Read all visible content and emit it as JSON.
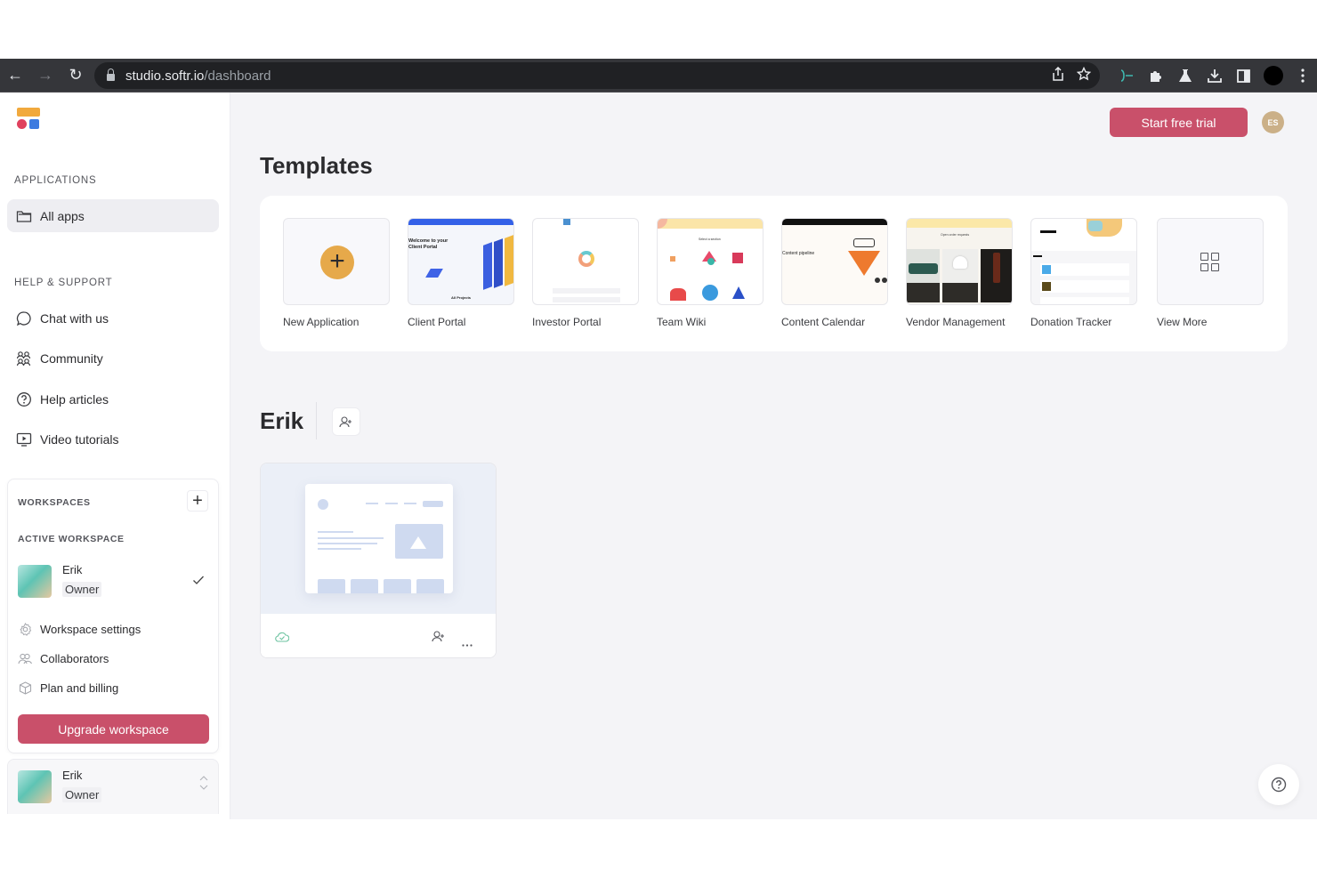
{
  "browser": {
    "url_host": "studio.softr.io",
    "url_path": "/dashboard",
    "nav": {
      "back": "←",
      "forward": "→",
      "reload": "↻"
    },
    "extensions": [
      "share-icon",
      "star-icon",
      "extension-app-icon",
      "puzzle-icon",
      "flask-icon",
      "download-icon",
      "sidebar-icon",
      "profile-icon",
      "menu-icon"
    ]
  },
  "sidebar": {
    "applications_title": "APPLICATIONS",
    "all_apps": "All apps",
    "help_title": "HELP & SUPPORT",
    "help_items": [
      {
        "label": "Chat with us",
        "icon": "chat-bubble-icon"
      },
      {
        "label": "Community",
        "icon": "community-icon"
      },
      {
        "label": "Help articles",
        "icon": "question-circle-icon"
      },
      {
        "label": "Video tutorials",
        "icon": "video-icon"
      }
    ],
    "workspaces": {
      "title": "WORKSPACES",
      "add": "+",
      "active_title": "ACTIVE WORKSPACE",
      "active": {
        "name": "Erik",
        "role": "Owner"
      },
      "links": [
        {
          "label": "Workspace settings",
          "icon": "gear-icon"
        },
        {
          "label": "Collaborators",
          "icon": "users-icon"
        },
        {
          "label": "Plan and billing",
          "icon": "box-icon"
        }
      ],
      "upgrade_label": "Upgrade workspace",
      "switcher": {
        "name": "Erik",
        "role": "Owner"
      }
    }
  },
  "header": {
    "trial_label": "Start free trial",
    "user_initials": "ES",
    "accent": "#c9506a"
  },
  "templates": {
    "title": "Templates",
    "items": [
      {
        "name": "New Application"
      },
      {
        "name": "Client Portal"
      },
      {
        "name": "Investor Portal"
      },
      {
        "name": "Team Wiki"
      },
      {
        "name": "Content Calendar"
      },
      {
        "name": "Vendor Management"
      },
      {
        "name": "Donation Tracker"
      },
      {
        "name": "View More"
      }
    ]
  },
  "workspace_section": {
    "title": "Erik"
  },
  "thumb_text": {
    "client_portal": "Welcome to your Client Portal",
    "client_portal_sub": "All Projects",
    "content_calendar": "Content pipeline",
    "team_wiki": "Select a section",
    "vendor": "Open order requests"
  }
}
